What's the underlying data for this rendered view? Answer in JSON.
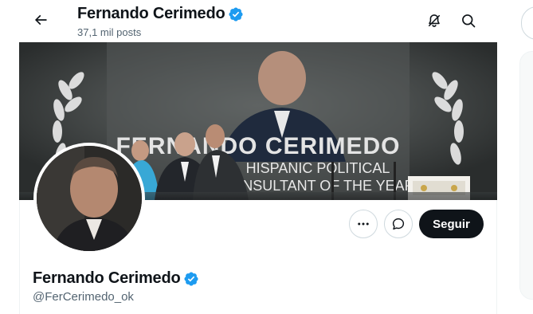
{
  "header": {
    "name": "Fernando Cerimedo",
    "posts_count": "37,1 mil posts"
  },
  "banner": {
    "title_line": "FERNANDO CERIMEDO",
    "subtitle_line1": "HISPANIC POLITICAL",
    "subtitle_line2": "CONSULTANT OF THE YEAR"
  },
  "actions": {
    "follow_label": "Seguir"
  },
  "profile": {
    "name": "Fernando Cerimedo",
    "handle": "@FerCerimedo_ok"
  },
  "colors": {
    "verified": "#1d9bf0",
    "text_primary": "#0f1419",
    "text_secondary": "#536471",
    "follow_bg": "#0f1419"
  },
  "icons": {
    "back": "arrow-left-icon",
    "notifications_off": "bell-slash-icon",
    "search": "search-icon",
    "more": "ellipsis-icon",
    "message": "message-bubble-icon",
    "verified": "verified-badge-icon"
  }
}
